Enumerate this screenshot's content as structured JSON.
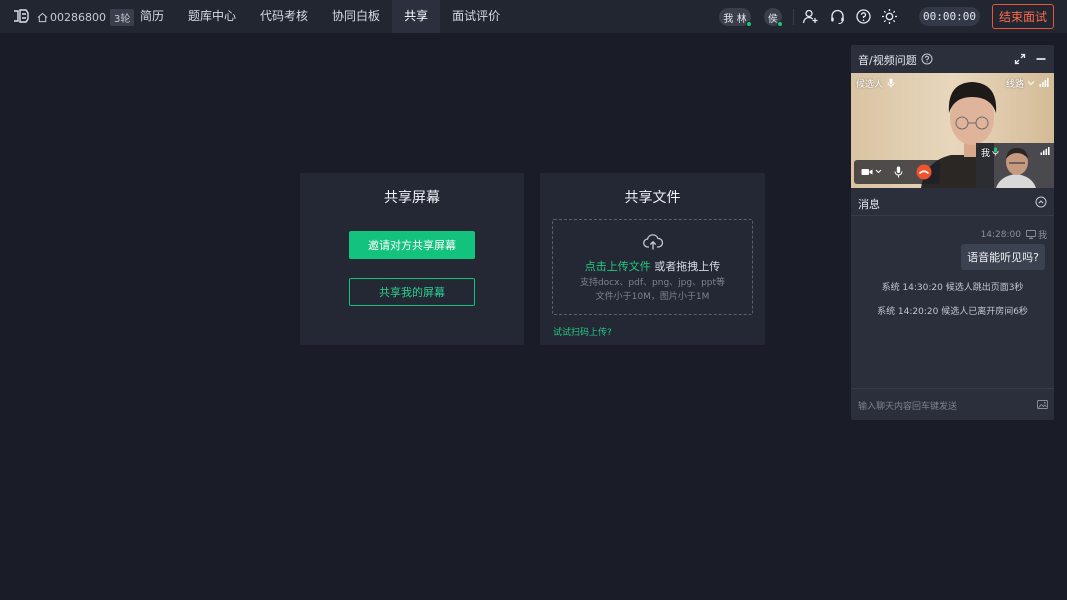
{
  "topbar": {
    "room_id": "00286800",
    "round": "3轮",
    "nav": [
      {
        "label": "简历",
        "active": false
      },
      {
        "label": "题库中心",
        "active": false
      },
      {
        "label": "代码考核",
        "active": false
      },
      {
        "label": "协同白板",
        "active": false
      },
      {
        "label": "共享",
        "active": true
      },
      {
        "label": "面试评价",
        "active": false
      }
    ],
    "avatar_me": {
      "a": "我",
      "b": "林"
    },
    "avatar_other": "侯",
    "timer": "00:00:00",
    "end_button": "结束面试",
    "icons": [
      "add-user-icon",
      "headset-icon",
      "help-icon",
      "brightness-icon"
    ]
  },
  "share_screen": {
    "title": "共享屏幕",
    "invite_button": "邀请对方共享屏幕",
    "share_mine_button": "共享我的屏幕"
  },
  "share_file": {
    "title": "共享文件",
    "upload_link": "点击上传文件",
    "drag_text": " 或者拖拽上传",
    "support_line": "支持docx、pdf、png、jpg、ppt等",
    "size_line": "文件小于10M，图片小于1M",
    "scan_link": "试试扫码上传?"
  },
  "panel": {
    "title": "音/视频问题",
    "video": {
      "candidate_label": "候选人",
      "line_label": "线路",
      "me_label": "我"
    },
    "messages": {
      "title": "消息",
      "time": "14:28:00",
      "sender": "我",
      "bubble": "语音能听见吗?",
      "system": [
        "系统 14:30:20  候选人跳出页面3秒",
        "系统 14:20:20  候选人已离开房间6秒"
      ],
      "input_placeholder": "输入聊天内容回车键发送"
    }
  },
  "colors": {
    "accent": "#13c27c",
    "danger": "#e8553a",
    "background": "#1a1d27",
    "card": "#242834"
  }
}
